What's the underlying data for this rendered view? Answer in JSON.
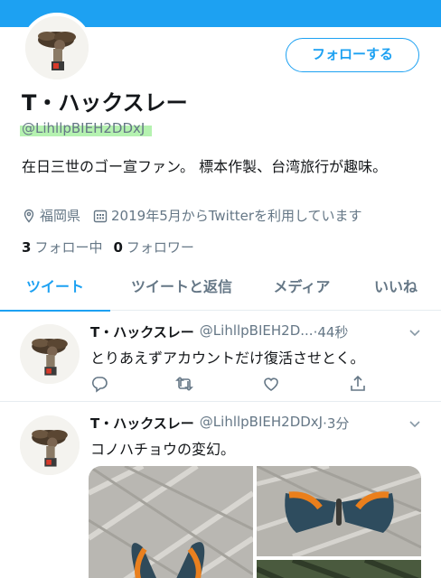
{
  "profile": {
    "name": "T・ハックスレー",
    "handle": "@LihllpBIEH2DDxJ",
    "follow_label": "フォローする",
    "bio": "在日三世のゴー宣ファン。 標本作製、台湾旅行が趣味。",
    "location": "福岡県",
    "joined": "2019年5月からTwitterを利用しています",
    "following_count": "3",
    "following_label": "フォロー中",
    "followers_count": "0",
    "followers_label": "フォロワー"
  },
  "tabs": [
    {
      "label": "ツイート",
      "active": true
    },
    {
      "label": "ツイートと返信",
      "active": false
    },
    {
      "label": "メディア",
      "active": false
    },
    {
      "label": "いいね",
      "active": false
    }
  ],
  "tweets": [
    {
      "name": "T・ハックスレー",
      "handle": "@LihllpBIEH2D...",
      "time": "·44秒",
      "text": "とりあえずアカウントだけ復活させとく。"
    },
    {
      "name": "T・ハックスレー",
      "handle": "@LihllpBIEH2DDxJ",
      "time": "·3分",
      "text": "コノハチョウの変幻。"
    }
  ],
  "colors": {
    "accent": "#1da1f2",
    "secondary_text": "#657786",
    "handle_highlight": "#b5f2b0"
  },
  "icons": [
    "location-pin-icon",
    "calendar-icon",
    "reply-icon",
    "retweet-icon",
    "like-icon",
    "share-icon",
    "chevron-down-icon"
  ]
}
